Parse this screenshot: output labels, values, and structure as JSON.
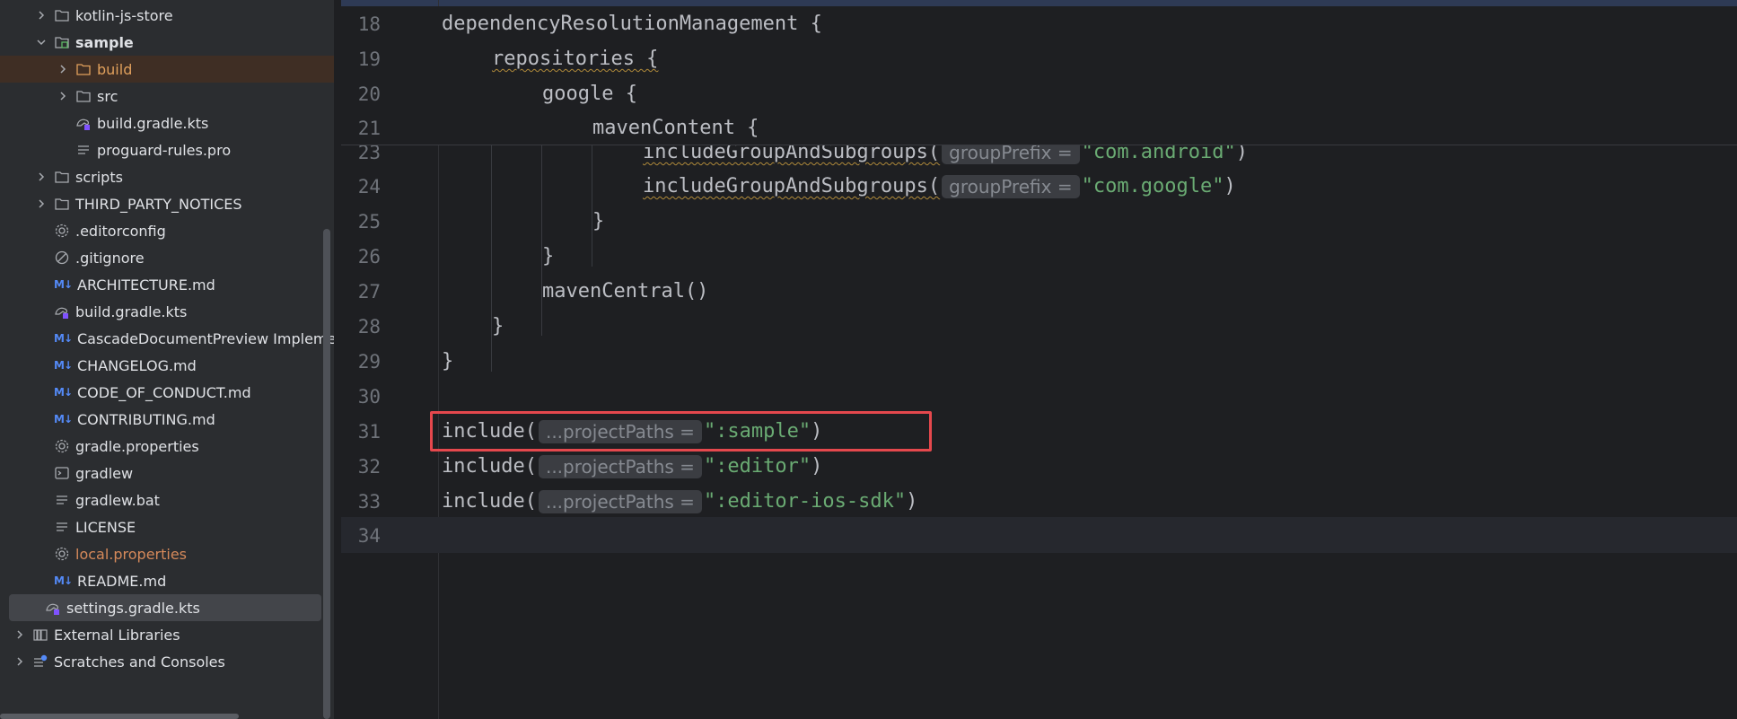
{
  "project_tree": {
    "items": [
      {
        "label": "kotlin-js-store",
        "icon": "folder-icon",
        "expandable": true,
        "expanded": false
      },
      {
        "label": "sample",
        "icon": "module-folder-icon",
        "expandable": true,
        "expanded": true
      },
      {
        "label": "build",
        "icon": "folder-orange-icon",
        "expandable": true,
        "expanded": false
      },
      {
        "label": "src",
        "icon": "folder-icon",
        "expandable": true,
        "expanded": false
      },
      {
        "label": "build.gradle.kts",
        "icon": "gradle-kts-icon"
      },
      {
        "label": "proguard-rules.pro",
        "icon": "text-file-icon"
      },
      {
        "label": "scripts",
        "icon": "folder-icon",
        "expandable": true,
        "expanded": false
      },
      {
        "label": "THIRD_PARTY_NOTICES",
        "icon": "folder-icon",
        "expandable": true,
        "expanded": false
      },
      {
        "label": ".editorconfig",
        "icon": "gear-icon"
      },
      {
        "label": ".gitignore",
        "icon": "ignore-icon"
      },
      {
        "label": "ARCHITECTURE.md",
        "icon": "markdown-icon"
      },
      {
        "label": "build.gradle.kts",
        "icon": "gradle-kts-icon"
      },
      {
        "label": "CascadeDocumentPreview Implementat",
        "icon": "markdown-icon"
      },
      {
        "label": "CHANGELOG.md",
        "icon": "markdown-icon"
      },
      {
        "label": "CODE_OF_CONDUCT.md",
        "icon": "markdown-icon"
      },
      {
        "label": "CONTRIBUTING.md",
        "icon": "markdown-icon"
      },
      {
        "label": "gradle.properties",
        "icon": "gear-icon"
      },
      {
        "label": "gradlew",
        "icon": "terminal-icon"
      },
      {
        "label": "gradlew.bat",
        "icon": "text-file-icon"
      },
      {
        "label": "LICENSE",
        "icon": "text-file-icon"
      },
      {
        "label": "local.properties",
        "icon": "gear-icon"
      },
      {
        "label": "README.md",
        "icon": "markdown-icon"
      },
      {
        "label": "settings.gradle.kts",
        "icon": "gradle-kts-icon",
        "selected": true
      },
      {
        "label": "External Libraries",
        "icon": "library-icon",
        "expandable": true,
        "expanded": false
      },
      {
        "label": "Scratches and Consoles",
        "icon": "scratches-icon",
        "expandable": true,
        "expanded": false
      }
    ],
    "markdown_badge": "M↓"
  },
  "editor": {
    "sticky_lines": [
      {
        "num": "18",
        "text": "dependencyResolutionManagement {"
      },
      {
        "num": "19",
        "text": "repositories {"
      },
      {
        "num": "20",
        "text": "google {"
      },
      {
        "num": "21",
        "text": "mavenContent {"
      }
    ],
    "lines": [
      {
        "num": "23",
        "call": "includeGroupAndSubgroups(",
        "hint": "groupPrefix =",
        "str": "\"com.android\"",
        "close": ")"
      },
      {
        "num": "24",
        "call": "includeGroupAndSubgroups(",
        "hint": "groupPrefix =",
        "str": "\"com.google\"",
        "close": ")"
      },
      {
        "num": "25",
        "text": "}"
      },
      {
        "num": "26",
        "text": "}"
      },
      {
        "num": "27",
        "text": "mavenCentral()"
      },
      {
        "num": "28",
        "text": "}"
      },
      {
        "num": "29",
        "text": "}"
      },
      {
        "num": "30",
        "text": ""
      },
      {
        "num": "31",
        "call": "include(",
        "hint": "...projectPaths =",
        "str": "\":sample\"",
        "close": ")"
      },
      {
        "num": "32",
        "call": "include(",
        "hint": "...projectPaths =",
        "str": "\":editor\"",
        "close": ")"
      },
      {
        "num": "33",
        "call": "include(",
        "hint": "...projectPaths =",
        "str": "\":editor-ios-sdk\"",
        "close": ")"
      },
      {
        "num": "34",
        "text": ""
      }
    ]
  },
  "colors": {
    "accent_highlight": "#e5484d",
    "string": "#6aab73",
    "hint_bg": "#3b3d42"
  }
}
